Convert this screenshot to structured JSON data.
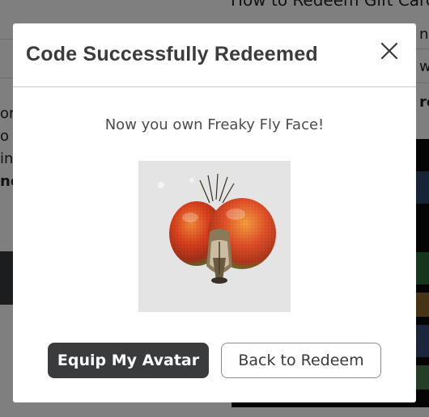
{
  "background": {
    "page_heading": "How to Redeem Gift Card",
    "side_text_fragments": [
      "ore",
      "o",
      "in",
      "no"
    ],
    "right_text_fragments": [
      "n",
      "w",
      "ro"
    ],
    "promo_text": "X"
  },
  "modal": {
    "title": "Code Successfully Redeemed",
    "close_icon": "close-icon",
    "message": "Now you own Freaky Fly Face!",
    "item": {
      "name": "Freaky Fly Face",
      "image_icon": "fly-face-icon"
    },
    "buttons": {
      "primary_label": "Equip My Avatar",
      "secondary_label": "Back to Redeem"
    }
  },
  "colors": {
    "button_primary_bg": "#393b3d",
    "text_primary": "#393b3d",
    "overlay": "rgba(0,0,0,0.5)"
  }
}
